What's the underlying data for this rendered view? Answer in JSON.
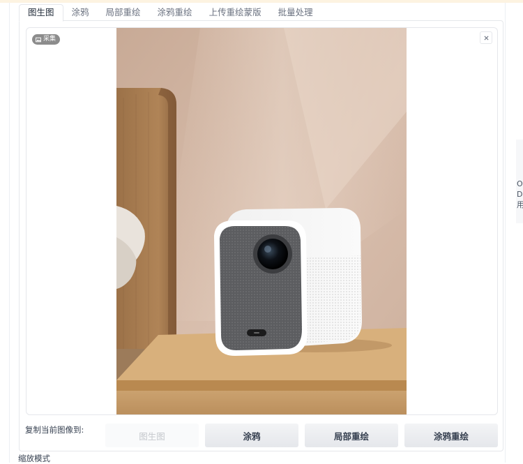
{
  "tabs": [
    {
      "label": "图生图",
      "active": true
    },
    {
      "label": "涂鸦",
      "active": false
    },
    {
      "label": "局部重绘",
      "active": false
    },
    {
      "label": "涂鸦重绘",
      "active": false
    },
    {
      "label": "上传重绘蒙版",
      "active": false
    },
    {
      "label": "批量处理",
      "active": false
    }
  ],
  "image_panel": {
    "badge_label": "采集",
    "badge_icon": "image-icon",
    "close_icon": "close-icon",
    "image_subject": "Xiaomi-style white compact projector with gray fabric front on wooden bedside table"
  },
  "copy_section": {
    "label": "复制当前图像到:",
    "buttons": [
      {
        "label": "图生图",
        "disabled": true
      },
      {
        "label": "涂鸦",
        "disabled": false
      },
      {
        "label": "局部重绘",
        "disabled": false
      },
      {
        "label": "涂鸦重绘",
        "disabled": false
      }
    ]
  },
  "zoom_label": "缩放模式",
  "side_text": [
    "O",
    "De",
    "用"
  ],
  "colors": {
    "top_band": "#fdf3e1",
    "badge_bg": "#8c8c8c",
    "button_bg": "#e5e7eb"
  }
}
